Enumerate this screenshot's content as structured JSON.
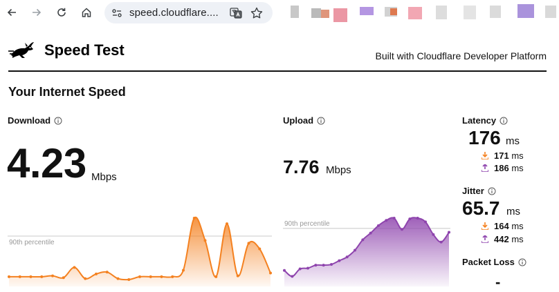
{
  "browser": {
    "url_display": "speed.cloudflare....",
    "nav_icons": [
      "back-arrow-icon",
      "forward-arrow-icon",
      "reload-icon",
      "home-icon"
    ],
    "omnibox_icons": [
      "site-info-icon",
      "translate-icon",
      "bookmark-star-icon"
    ]
  },
  "header": {
    "title": "Speed Test",
    "built_with": "Built with Cloudflare Developer Platform",
    "logo_icon": "rabbit-logo-icon"
  },
  "section_title": "Your Internet Speed",
  "download": {
    "label": "Download",
    "value": "4.23",
    "unit": "Mbps",
    "color": "#f48120",
    "percentile_label": "90th percentile",
    "chart_data": {
      "type": "area",
      "series": [
        {
          "values": [
            0.6,
            0.6,
            0.6,
            0.6,
            0.7,
            0.5,
            1.6,
            0.4,
            0.9,
            1.1,
            0.4,
            0.3,
            0.6,
            0.6,
            0.6,
            0.6,
            1.3,
            6.9,
            4.5,
            0.6,
            6.3,
            0.7,
            4.2,
            3.6,
            1.0
          ]
        }
      ],
      "percentile_90_fraction": 0.72
    }
  },
  "upload": {
    "label": "Upload",
    "value": "7.76",
    "unit": "Mbps",
    "color": "#8e44ad",
    "percentile_label": "90th percentile",
    "chart_data": {
      "type": "area",
      "series": [
        {
          "values": [
            1.6,
            0.8,
            1.8,
            1.9,
            2.3,
            2.3,
            2.4,
            2.9,
            3.4,
            4.3,
            5.7,
            6.6,
            7.6,
            8.3,
            8.6,
            7.1,
            8.5,
            8.6,
            8.1,
            6.4,
            5.4,
            6.7
          ]
        }
      ],
      "percentile_90_fraction": 0.84
    }
  },
  "latency": {
    "label": "Latency",
    "value": "176",
    "unit": "ms",
    "down_value": "171",
    "down_unit": "ms",
    "up_value": "186",
    "up_unit": "ms"
  },
  "jitter": {
    "label": "Jitter",
    "value": "65.7",
    "unit": "ms",
    "down_value": "164",
    "down_unit": "ms",
    "up_value": "442",
    "up_unit": "ms"
  },
  "packet_loss": {
    "label": "Packet Loss",
    "value": "-"
  }
}
